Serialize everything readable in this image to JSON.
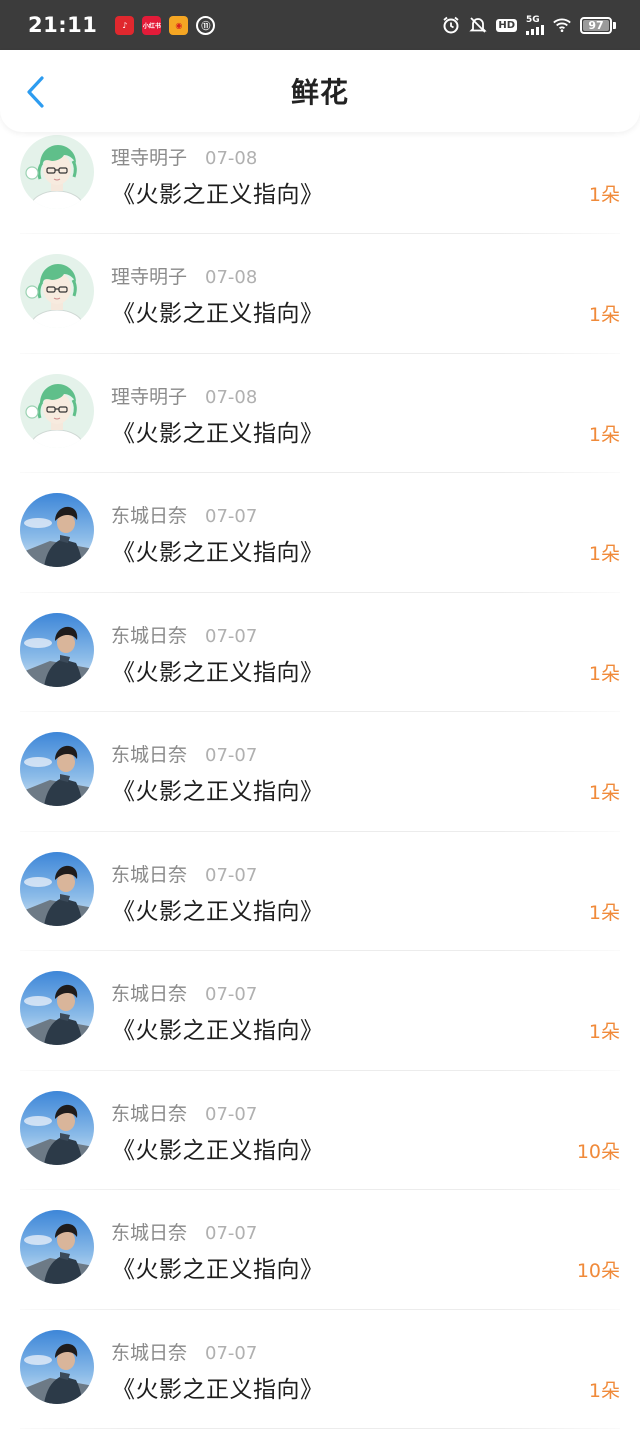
{
  "status_bar": {
    "time": "21:11",
    "notification_icons": [
      "netease-music-icon",
      "xiaohongshu-icon",
      "weibo-icon",
      "sync-icon"
    ],
    "system_icons": [
      "alarm-icon",
      "mute-icon",
      "hd-icon",
      "5g-signal-icon",
      "wifi-icon",
      "battery-icon"
    ],
    "hd_label": "HD",
    "network_label": "5G",
    "battery_level": "97"
  },
  "nav": {
    "title": "鲜花",
    "accent_color": "#2d9cf0"
  },
  "items": [
    {
      "user": "理寺明子",
      "date": "07-08",
      "book": "《火影之正义指向》",
      "count": "1朵",
      "avatar": "green-hair-avatar"
    },
    {
      "user": "理寺明子",
      "date": "07-08",
      "book": "《火影之正义指向》",
      "count": "1朵",
      "avatar": "green-hair-avatar"
    },
    {
      "user": "理寺明子",
      "date": "07-08",
      "book": "《火影之正义指向》",
      "count": "1朵",
      "avatar": "green-hair-avatar"
    },
    {
      "user": "东城日奈",
      "date": "07-07",
      "book": "《火影之正义指向》",
      "count": "1朵",
      "avatar": "sky-photo-avatar"
    },
    {
      "user": "东城日奈",
      "date": "07-07",
      "book": "《火影之正义指向》",
      "count": "1朵",
      "avatar": "sky-photo-avatar"
    },
    {
      "user": "东城日奈",
      "date": "07-07",
      "book": "《火影之正义指向》",
      "count": "1朵",
      "avatar": "sky-photo-avatar"
    },
    {
      "user": "东城日奈",
      "date": "07-07",
      "book": "《火影之正义指向》",
      "count": "1朵",
      "avatar": "sky-photo-avatar"
    },
    {
      "user": "东城日奈",
      "date": "07-07",
      "book": "《火影之正义指向》",
      "count": "1朵",
      "avatar": "sky-photo-avatar"
    },
    {
      "user": "东城日奈",
      "date": "07-07",
      "book": "《火影之正义指向》",
      "count": "10朵",
      "avatar": "sky-photo-avatar"
    },
    {
      "user": "东城日奈",
      "date": "07-07",
      "book": "《火影之正义指向》",
      "count": "10朵",
      "avatar": "sky-photo-avatar"
    },
    {
      "user": "东城日奈",
      "date": "07-07",
      "book": "《火影之正义指向》",
      "count": "1朵",
      "avatar": "sky-photo-avatar"
    }
  ],
  "colors": {
    "count": "#f08a3a",
    "username": "#8a8a8a",
    "date": "#b0b0b0",
    "title": "#1e1e1e"
  }
}
